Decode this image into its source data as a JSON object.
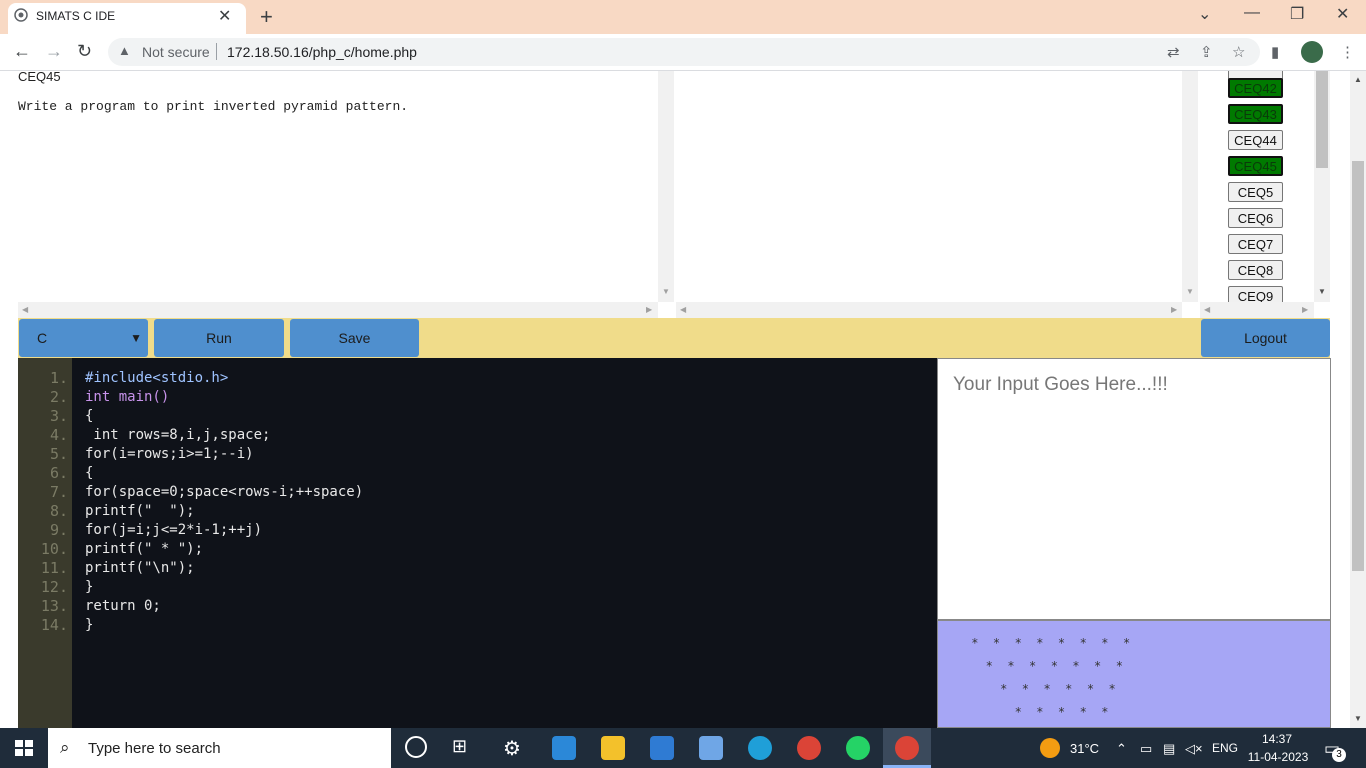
{
  "browser": {
    "tab_title": "SIMATS C IDE",
    "new_tab": "+",
    "tab_close": "✕",
    "window_controls": [
      "⌄",
      "—",
      "❐",
      "✕"
    ],
    "security": "Not secure",
    "url": "172.18.50.16/php_c/home.php"
  },
  "question": {
    "id": "CEQ45",
    "text": "Write a program to print inverted pyramid pattern."
  },
  "question_list": [
    {
      "label": "CEQ42",
      "state": "solved"
    },
    {
      "label": "CEQ43",
      "state": "solved"
    },
    {
      "label": "CEQ44",
      "state": "unsolved"
    },
    {
      "label": "CEQ45",
      "state": "solved"
    },
    {
      "label": "CEQ5",
      "state": "unsolved"
    },
    {
      "label": "CEQ6",
      "state": "unsolved"
    },
    {
      "label": "CEQ7",
      "state": "unsolved"
    },
    {
      "label": "CEQ8",
      "state": "unsolved"
    },
    {
      "label": "CEQ9",
      "state": "unsolved"
    }
  ],
  "toolbar": {
    "language": "C",
    "run_label": "Run",
    "save_label": "Save",
    "logout_label": "Logout"
  },
  "editor": {
    "line_numbers": [
      "1.",
      "2.",
      "3.",
      "4.",
      "5.",
      "6.",
      "7.",
      "8.",
      "9.",
      "10.",
      "11.",
      "12.",
      "13.",
      "14."
    ],
    "lines": [
      "#include<stdio.h>",
      "int main()",
      "{",
      " int rows=8,i,j,space;",
      "for(i=rows;i>=1;--i)",
      "{",
      "for(space=0;space<rows-i;++space)",
      "printf(\"  \");",
      "for(j=i;j<=2*i-1;++j)",
      "printf(\" * \");",
      "printf(\"\\n\");",
      "}",
      "return 0;",
      "}"
    ]
  },
  "input": {
    "placeholder": "Your Input Goes Here...!!!"
  },
  "output": {
    "lines": [
      " *  *  *  *  *  *  *  *",
      "   *  *  *  *  *  *  *",
      "     *  *  *  *  *  *",
      "       *  *  *  *  *"
    ]
  },
  "taskbar": {
    "search_placeholder": "Type here to search",
    "temperature": "31°C",
    "language": "ENG",
    "time": "14:37",
    "date": "11-04-2023",
    "notification_count": "3"
  },
  "colors": {
    "solved": "#007a00",
    "toolbar_bg": "#f0dc8a",
    "button_blue": "#4f8fce",
    "editor_bg": "#0f1219",
    "output_bg": "#a6a6f5"
  }
}
